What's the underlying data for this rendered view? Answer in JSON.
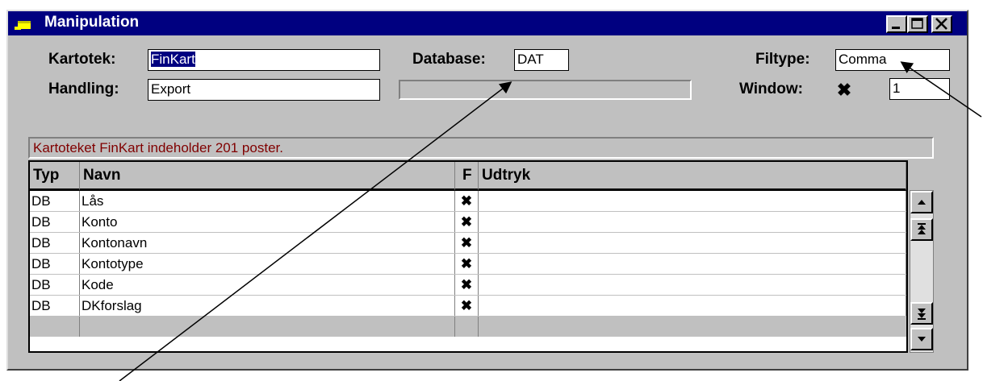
{
  "window": {
    "title": "Manipulation",
    "icon": "app-window-icon",
    "controls": [
      "minimize-icon",
      "maximize-icon",
      "close-icon"
    ]
  },
  "form": {
    "kartotek_label": "Kartotek:",
    "kartotek_value": "FinKart",
    "handling_label": "Handling:",
    "handling_value": "Export",
    "database_label": "Database:",
    "database_value": "DAT",
    "database_status": "",
    "filtype_label": "Filtype:",
    "filtype_value": "Comma",
    "window_label": "Window:",
    "window_checked": "✖",
    "window_value": "1"
  },
  "status_message": "Kartoteket FinKart indeholder 201 poster.",
  "table": {
    "columns": [
      "Typ",
      "Navn",
      "F",
      "Udtryk"
    ],
    "rows": [
      {
        "typ": "DB",
        "navn": "Lås",
        "f": "✖",
        "udtryk": ""
      },
      {
        "typ": "DB",
        "navn": "Konto",
        "f": "✖",
        "udtryk": ""
      },
      {
        "typ": "DB",
        "navn": "Kontonavn",
        "f": "✖",
        "udtryk": ""
      },
      {
        "typ": "DB",
        "navn": "Kontotype",
        "f": "✖",
        "udtryk": ""
      },
      {
        "typ": "DB",
        "navn": "Kode",
        "f": "✖",
        "udtryk": ""
      },
      {
        "typ": "DB",
        "navn": "DKforslag",
        "f": "✖",
        "udtryk": ""
      }
    ]
  },
  "scroll_buttons": [
    "scroll-up-icon",
    "scroll-page-up-icon",
    "scroll-page-down-icon",
    "scroll-down-icon"
  ],
  "colors": {
    "titlebar": "#000080",
    "window": "#c0c0c0",
    "status_text": "#800000"
  }
}
